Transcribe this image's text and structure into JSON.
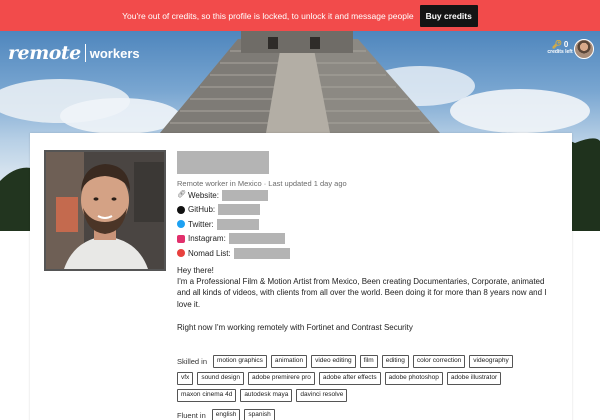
{
  "banner": {
    "message": "You're out of credits, so this profile is locked, to unlock it and message people",
    "button_label": "Buy credits",
    "color": "#f24b4b"
  },
  "header": {
    "logo_main": "remote",
    "logo_sub": "workers",
    "credits_count": "0",
    "credits_label": "credits left"
  },
  "profile": {
    "subtitle": "Remote worker in Mexico · Last updated 1 day ago",
    "links": [
      {
        "label": "Website:",
        "icon": "link-icon"
      },
      {
        "label": "GitHub:",
        "icon": "github-icon"
      },
      {
        "label": "Twitter:",
        "icon": "twitter-icon"
      },
      {
        "label": "Instagram:",
        "icon": "instagram-icon"
      },
      {
        "label": "Nomad List:",
        "icon": "nomadlist-icon"
      }
    ],
    "bio": [
      "Hey there!",
      "I'm a Professional Film & Motion Artist from Mexico, Been creating Documentaries, Corporate, animated and all kinds of videos, with clients from all over the world. Been doing it for more than 8 years now and I love it.",
      "Right now I'm working remotely with Fortinet and Contrast Security"
    ],
    "skills_label": "Skilled in",
    "skills": [
      "motion graphics",
      "animation",
      "video editing",
      "film",
      "editing",
      "color correction",
      "videography",
      "vfx",
      "sound design",
      "adobe premirere pro",
      "adobe after effects",
      "adobe photoshop",
      "adobe illustrator",
      "maxon cinema 4d",
      "autodesk maya",
      "davinci resolve"
    ],
    "fluent_label": "Fluent in",
    "languages": [
      "english",
      "spanish"
    ]
  }
}
